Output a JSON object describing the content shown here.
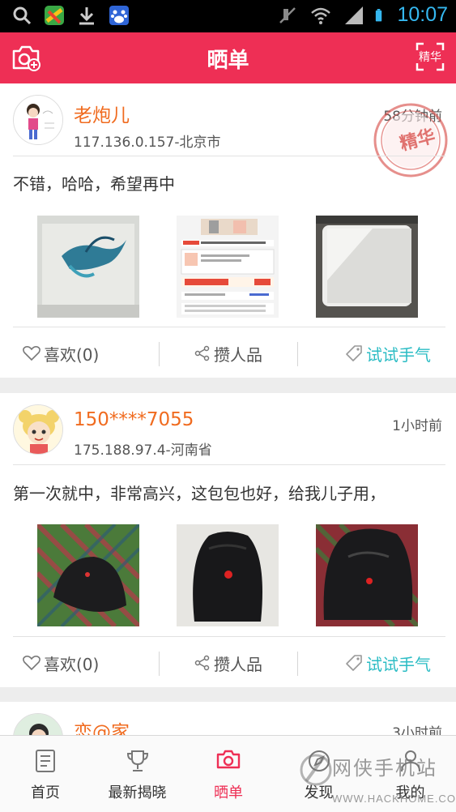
{
  "status_bar": {
    "time": "10:07"
  },
  "header": {
    "title": "晒单",
    "featured_label": "精华"
  },
  "posts": [
    {
      "user": "老炮儿",
      "ip_location": "117.136.0.157-北京市",
      "time": "58分钟前",
      "stamp": "精华",
      "content": "不错，哈哈，希望再中",
      "actions": {
        "like": "喜欢(0)",
        "rp": "攒人品",
        "lucky": "试试手气"
      }
    },
    {
      "user": "150****7055",
      "ip_location": "175.188.97.4-河南省",
      "time": "1小时前",
      "content": "第一次就中，非常高兴，这包包也好，给我儿子用，",
      "actions": {
        "like": "喜欢(0)",
        "rp": "攒人品",
        "lucky": "试试手气"
      }
    },
    {
      "user": "恋@家",
      "time": "3小时前"
    }
  ],
  "nav": {
    "items": [
      {
        "label": "首页"
      },
      {
        "label": "最新揭晓"
      },
      {
        "label": "晒单"
      },
      {
        "label": "发现"
      },
      {
        "label": "我的"
      }
    ]
  },
  "watermark": {
    "text": "网侠手机站",
    "url": "WWW.HACKHOME.COM"
  },
  "colors": {
    "brand": "#ee2f55",
    "username": "#f06b1f",
    "lucky": "#2bbcc4",
    "status_time": "#35b8f0"
  }
}
